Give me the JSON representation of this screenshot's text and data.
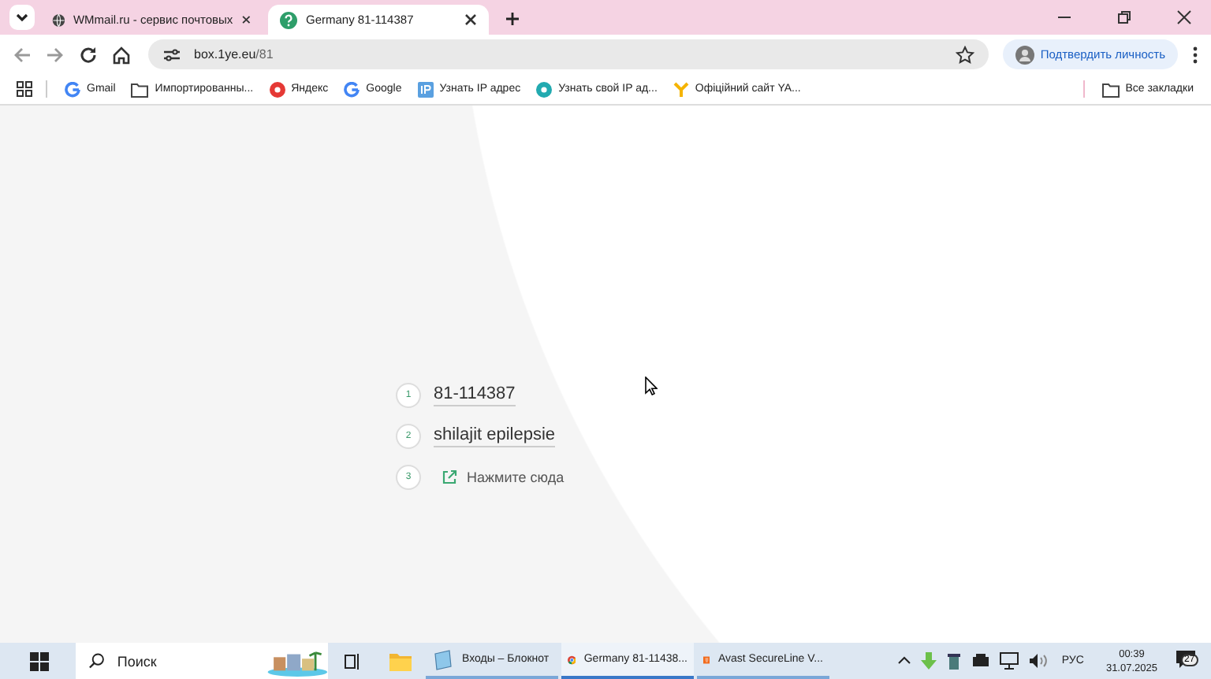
{
  "tabs": [
    {
      "title": "WMmail.ru - сервис почтовых",
      "selected": false,
      "kind": "globe"
    },
    {
      "title": "Germany 81-114387",
      "selected": true,
      "kind": "help"
    }
  ],
  "address_bar": {
    "url_host": "box.1ye.eu",
    "url_path": "/81"
  },
  "profile_button": {
    "label": "Подтвердить личность"
  },
  "bookmarks": [
    {
      "label": "Gmail",
      "kind": "google"
    },
    {
      "label": "Импортированны...",
      "kind": "folder"
    },
    {
      "label": "Яндекс",
      "kind": "yandex"
    },
    {
      "label": "Google",
      "kind": "google"
    },
    {
      "label": "Узнать IP адрес",
      "kind": "ip"
    },
    {
      "label": "Узнать свой IP ад...",
      "kind": "w"
    },
    {
      "label": "Офіційний сайт YA...",
      "kind": "y"
    }
  ],
  "all_bookmarks": {
    "label": "Все закладки"
  },
  "steps": [
    {
      "number": "1",
      "kind": "text",
      "text": "81-114387"
    },
    {
      "number": "2",
      "kind": "text",
      "text": "shilajit epilepsie"
    },
    {
      "number": "3",
      "kind": "link",
      "text": "Нажмите сюда"
    }
  ],
  "taskbar": {
    "search_placeholder": "Поиск",
    "apps": [
      {
        "label": "Входы – Блокнот",
        "kind": "notepad",
        "selected": false
      },
      {
        "label": "Germany 81-11438...",
        "kind": "chrome",
        "selected": true
      },
      {
        "label": "Avast SecureLine V...",
        "kind": "avast",
        "selected": false
      }
    ],
    "language": "РУС",
    "time": "00:39",
    "date": "31.07.2025",
    "notifications": "27"
  }
}
